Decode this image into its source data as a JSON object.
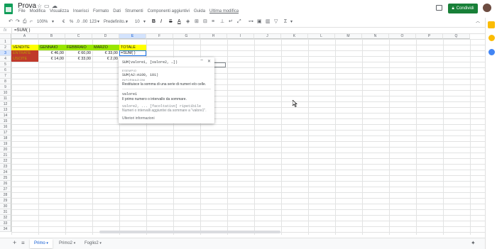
{
  "app": {
    "doc_title": "Prova",
    "menus": [
      "File",
      "Modifica",
      "Visualizza",
      "Inserisci",
      "Formato",
      "Dati",
      "Strumenti",
      "Componenti aggiuntivi",
      "Guida"
    ],
    "last_edit": "Ultima modifica",
    "share_label": "Condividi",
    "brand_color": "#0f9d58",
    "share_color": "#188038"
  },
  "toolbar": {
    "zoom": "100%",
    "currency": "€",
    "percent": "%",
    "dec0": ".0",
    "dec00": ".00",
    "num_format": "123",
    "font": "Predefinito...",
    "font_size": "10",
    "bold": "B",
    "italic": "I",
    "strike": "S",
    "text_color": "A",
    "sum": "Σ"
  },
  "formula_bar": {
    "fx": "fx",
    "value": "=SUM( )"
  },
  "columns": [
    "A",
    "B",
    "C",
    "D",
    "E",
    "F",
    "G",
    "H",
    "I",
    "J",
    "K",
    "L",
    "M",
    "N",
    "O",
    "P",
    "Q"
  ],
  "rows": [
    "1",
    "2",
    "3",
    "4",
    "5",
    "6",
    "7",
    "8",
    "9",
    "10",
    "11",
    "12",
    "13",
    "14",
    "15",
    "16",
    "17",
    "18",
    "19",
    "20",
    "21",
    "22",
    "23",
    "24",
    "25",
    "26",
    "27",
    "28",
    "29",
    "30",
    "31",
    "32",
    "33",
    "34"
  ],
  "table": {
    "headers": [
      "VENDITE",
      "GENNAIO",
      "FEBBRAIO",
      "MARZO",
      "TOTALE"
    ],
    "rows": [
      [
        "ENTRATE",
        "€ 46,00",
        "€ 60,00",
        "€ 33,00",
        "=SUM( )"
      ],
      [
        "USCITE",
        "€ 14,00",
        "€ 33,00",
        "€ 2,00",
        ""
      ]
    ]
  },
  "tooltip": {
    "signature": "SUM(valore1, [valore2, …])",
    "example_label": "ESEMPIO",
    "example": "SUM(A2:A100, 101)",
    "info_label": "INFORMAZIONI",
    "info": "Restituisce la somma di una serie di numeri e/o celle.",
    "arg1_name": "valore1",
    "arg1_desc": "Il primo numero o intervallo da sommare.",
    "arg2_name": "valore2, ... [facoltativo] ripetibile",
    "arg2_desc": "Numeri o intervalli aggiuntivi da sommare a \"valore1\".",
    "more": "Ulteriori informazioni",
    "collapse": "−",
    "close": "✕"
  },
  "sheets": {
    "add": "+",
    "list_icon": "≡",
    "tabs": [
      "Primo",
      "Primo2",
      "Foglio2"
    ],
    "active": "Primo"
  }
}
